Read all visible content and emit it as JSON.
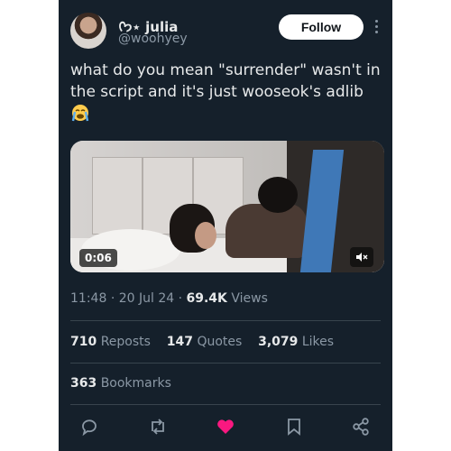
{
  "user": {
    "display_name": "ᢉ𐭩⋆ julia",
    "handle": "@woohyey"
  },
  "follow_label": "Follow",
  "tweet": {
    "text": "what do you mean \"surrender\" wasn't in the script and it's just wooseok's adlib",
    "emoji": "loudly-crying-face"
  },
  "video": {
    "duration": "0:06",
    "mute_icon": "volume-muted-icon"
  },
  "meta": {
    "time": "11:48",
    "date": "20 Jul 24",
    "views_count": "69.4K",
    "views_label": "Views"
  },
  "stats": {
    "reposts_count": "710",
    "reposts_label": "Reposts",
    "quotes_count": "147",
    "quotes_label": "Quotes",
    "likes_count": "3,079",
    "likes_label": "Likes",
    "bookmarks_count": "363",
    "bookmarks_label": "Bookmarks"
  },
  "colors": {
    "background": "#15202b",
    "text": "#e7e9ea",
    "muted": "#8b98a5",
    "like_pink": "#f91880"
  },
  "actions": [
    "reply-icon",
    "repost-icon",
    "like-icon",
    "bookmark-icon",
    "share-icon"
  ]
}
